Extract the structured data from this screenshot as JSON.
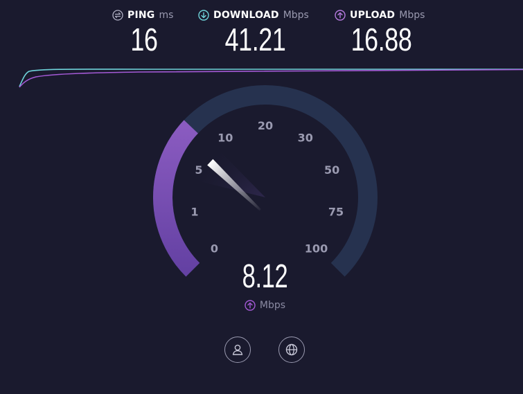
{
  "stats": {
    "ping": {
      "title": "PING",
      "unit": "ms",
      "value": "16",
      "icon": "ping-icon"
    },
    "download": {
      "title": "DOWNLOAD",
      "unit": "Mbps",
      "value": "41.21",
      "icon": "download-arrow-icon"
    },
    "upload": {
      "title": "UPLOAD",
      "unit": "Mbps",
      "value": "16.88",
      "icon": "upload-arrow-icon"
    }
  },
  "gauge": {
    "ticks": [
      "0",
      "1",
      "5",
      "10",
      "20",
      "30",
      "50",
      "75",
      "100"
    ],
    "value": "8.12",
    "unit": "Mbps",
    "unit_icon": "upload-arrow-icon",
    "needle_value": 8.12
  },
  "buttons": {
    "profile": {
      "icon": "user-profile-icon"
    },
    "globe": {
      "icon": "globe-icon"
    }
  },
  "colors": {
    "background": "#1a1a2e",
    "download": "#6fd3da",
    "upload": "#a45ad6",
    "gauge_track": "#26324f",
    "gauge_fill": "#7b55b5",
    "tick_label": "#9a9ab0"
  }
}
